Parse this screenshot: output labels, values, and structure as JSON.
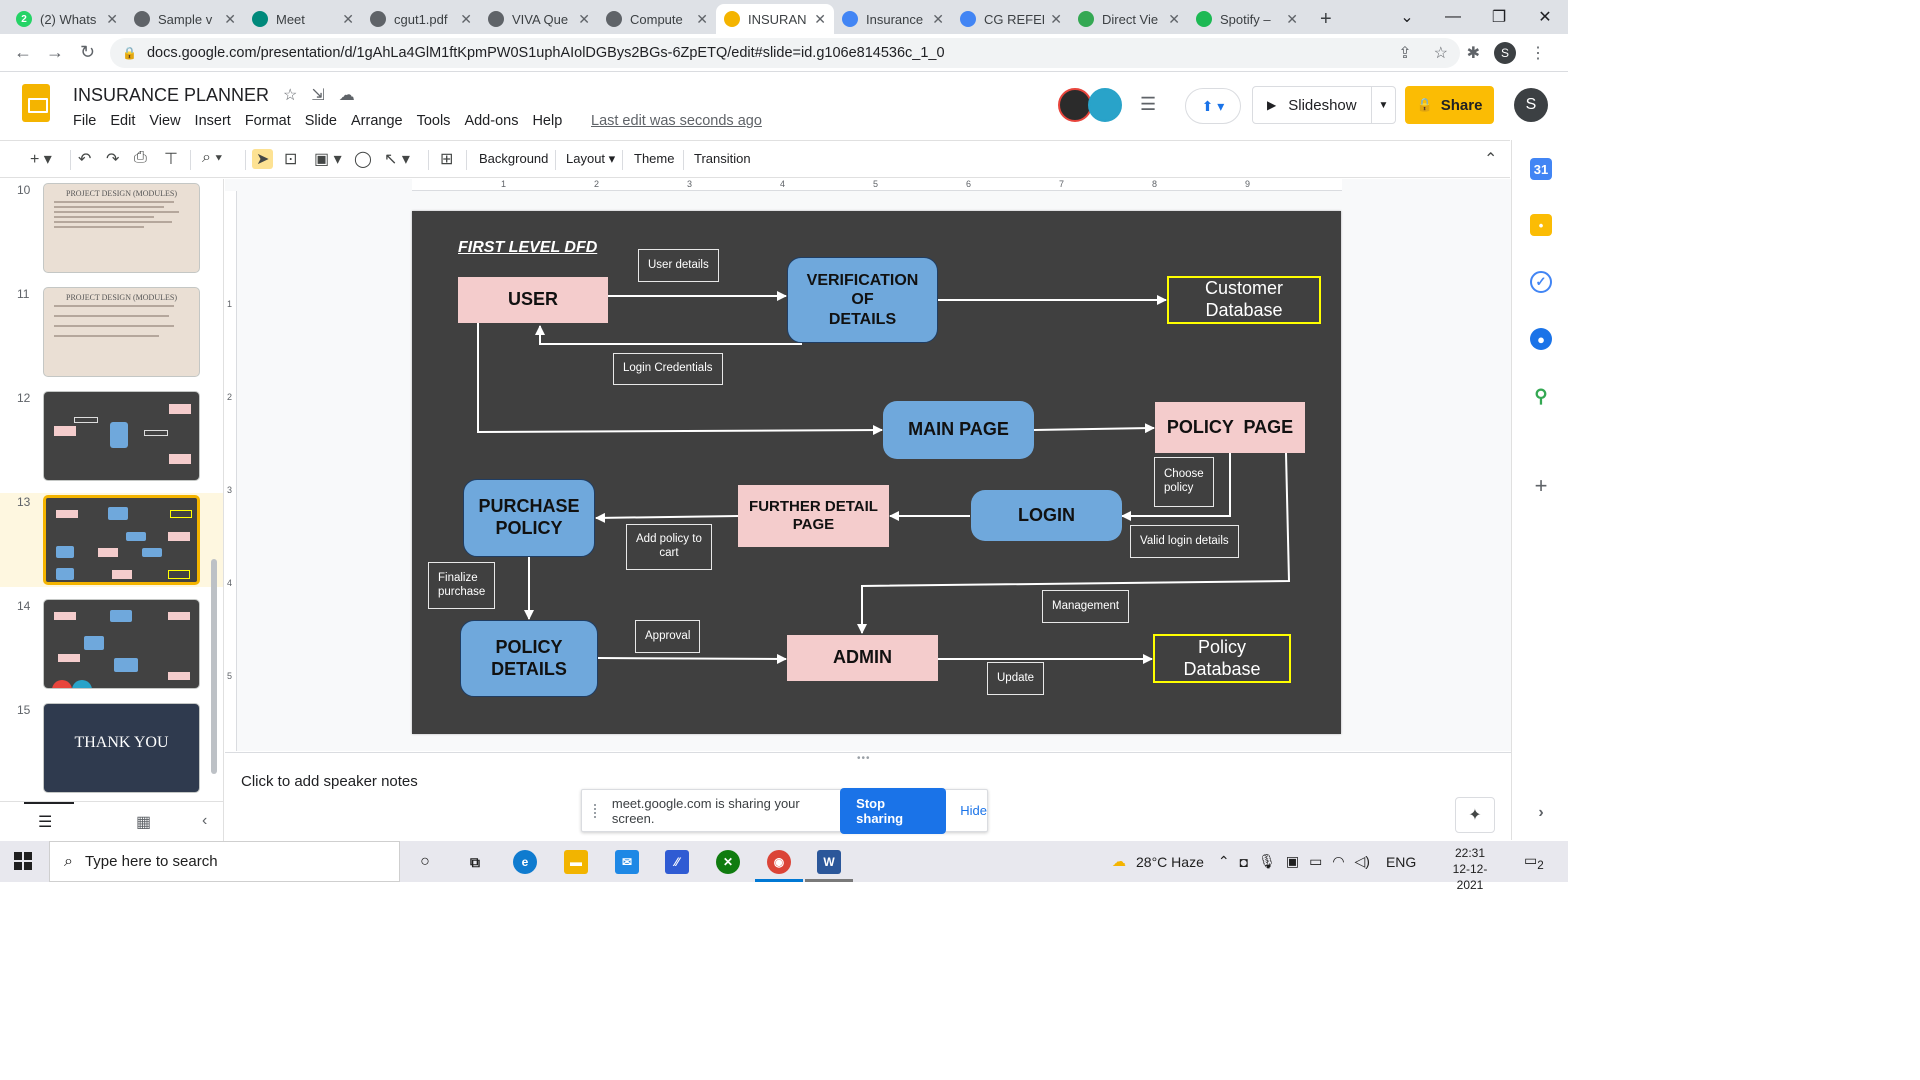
{
  "browser": {
    "tabs": [
      {
        "label": "(2) Whats",
        "favicon": "whatsapp-icon",
        "color": "#25d366",
        "glyph": "2"
      },
      {
        "label": "Sample v",
        "favicon": "globe-icon",
        "color": "#5f6368",
        "glyph": ""
      },
      {
        "label": "Meet",
        "favicon": "meet-icon",
        "color": "#00897b",
        "glyph": ""
      },
      {
        "label": "cgut1.pdf",
        "favicon": "globe-icon",
        "color": "#5f6368",
        "glyph": ""
      },
      {
        "label": "VIVA Que",
        "favicon": "globe-icon",
        "color": "#5f6368",
        "glyph": ""
      },
      {
        "label": "Compute",
        "favicon": "globe-icon",
        "color": "#5f6368",
        "glyph": ""
      },
      {
        "label": "INSURAN",
        "favicon": "slides-icon",
        "color": "#f4b400",
        "glyph": ""
      },
      {
        "label": "Insurance",
        "favicon": "docs-icon",
        "color": "#4285f4",
        "glyph": ""
      },
      {
        "label": "CG REFER",
        "favicon": "docs-icon",
        "color": "#4285f4",
        "glyph": ""
      },
      {
        "label": "Direct Vie",
        "favicon": "link-icon",
        "color": "#34a853",
        "glyph": ""
      },
      {
        "label": "Spotify –",
        "favicon": "spotify-icon",
        "color": "#1db954",
        "glyph": ""
      }
    ],
    "new_tab": "+",
    "url": "docs.google.com/presentation/d/1gAhLa4GlM1ftKpmPW0S1uphAIolDGBys2BGs-6ZpETQ/edit#slide=id.g106e814536c_1_0",
    "profile_initial": "S"
  },
  "slides": {
    "title": "INSURANCE PLANNER",
    "menu": [
      "File",
      "Edit",
      "View",
      "Insert",
      "Format",
      "Slide",
      "Arrange",
      "Tools",
      "Add-ons",
      "Help"
    ],
    "last_edit": "Last edit was seconds ago",
    "slideshow_label": "Slideshow",
    "share_label": "Share",
    "user_initial": "S",
    "toolbar": {
      "background": "Background",
      "layout": "Layout",
      "theme": "Theme",
      "transition": "Transition"
    },
    "filmstrip": {
      "slides": [
        {
          "num": "10",
          "title": "PROJECT DESIGN (MODULES)"
        },
        {
          "num": "11",
          "title": "PROJECT DESIGN (MODULES)"
        },
        {
          "num": "12",
          "title": ""
        },
        {
          "num": "13",
          "title": ""
        },
        {
          "num": "14",
          "title": ""
        },
        {
          "num": "15",
          "title": "THANK YOU"
        }
      ]
    },
    "ruler_top": [
      "1",
      "2",
      "3",
      "4",
      "5",
      "6",
      "7",
      "8",
      "9"
    ],
    "ruler_left": [
      "1",
      "2",
      "3",
      "4",
      "5"
    ],
    "speaker_notes_placeholder": "Click to add speaker notes"
  },
  "diagram": {
    "title": "FIRST LEVEL DFD",
    "nodes": {
      "user": "USER",
      "verification": "VERIFICATION\nOF\nDETAILS",
      "customer_db": "Customer\nDatabase",
      "main_page": "MAIN PAGE",
      "policy_page": "POLICY  PAGE",
      "purchase_policy": "PURCHASE\nPOLICY",
      "further_detail": "FURTHER  DETAIL\nPAGE",
      "login": "LOGIN",
      "policy_details": "POLICY\nDETAILS",
      "admin": "ADMIN",
      "policy_db": "Policy\nDatabase"
    },
    "labels": {
      "user_details": "User details",
      "login_credentials": "Login Credentials",
      "choose_policy": "Choose\npolicy",
      "add_policy": "Add policy to\ncart",
      "valid_login": "Valid login details",
      "finalize": "Finalize\npurchase",
      "management": "Management",
      "approval": "Approval",
      "update": "Update"
    },
    "colors": {
      "slide_bg": "#404040",
      "pink": "#f4cccc",
      "blue": "#6fa8dc",
      "db_border": "#ffff00"
    }
  },
  "screen_share": {
    "message": "meet.google.com is sharing your screen.",
    "stop": "Stop sharing",
    "hide": "Hide"
  },
  "taskbar": {
    "search_placeholder": "Type here to search",
    "weather": "28°C  Haze",
    "language": "ENG",
    "time": "22:31",
    "date": "12-12-2021",
    "notifications": "2"
  }
}
